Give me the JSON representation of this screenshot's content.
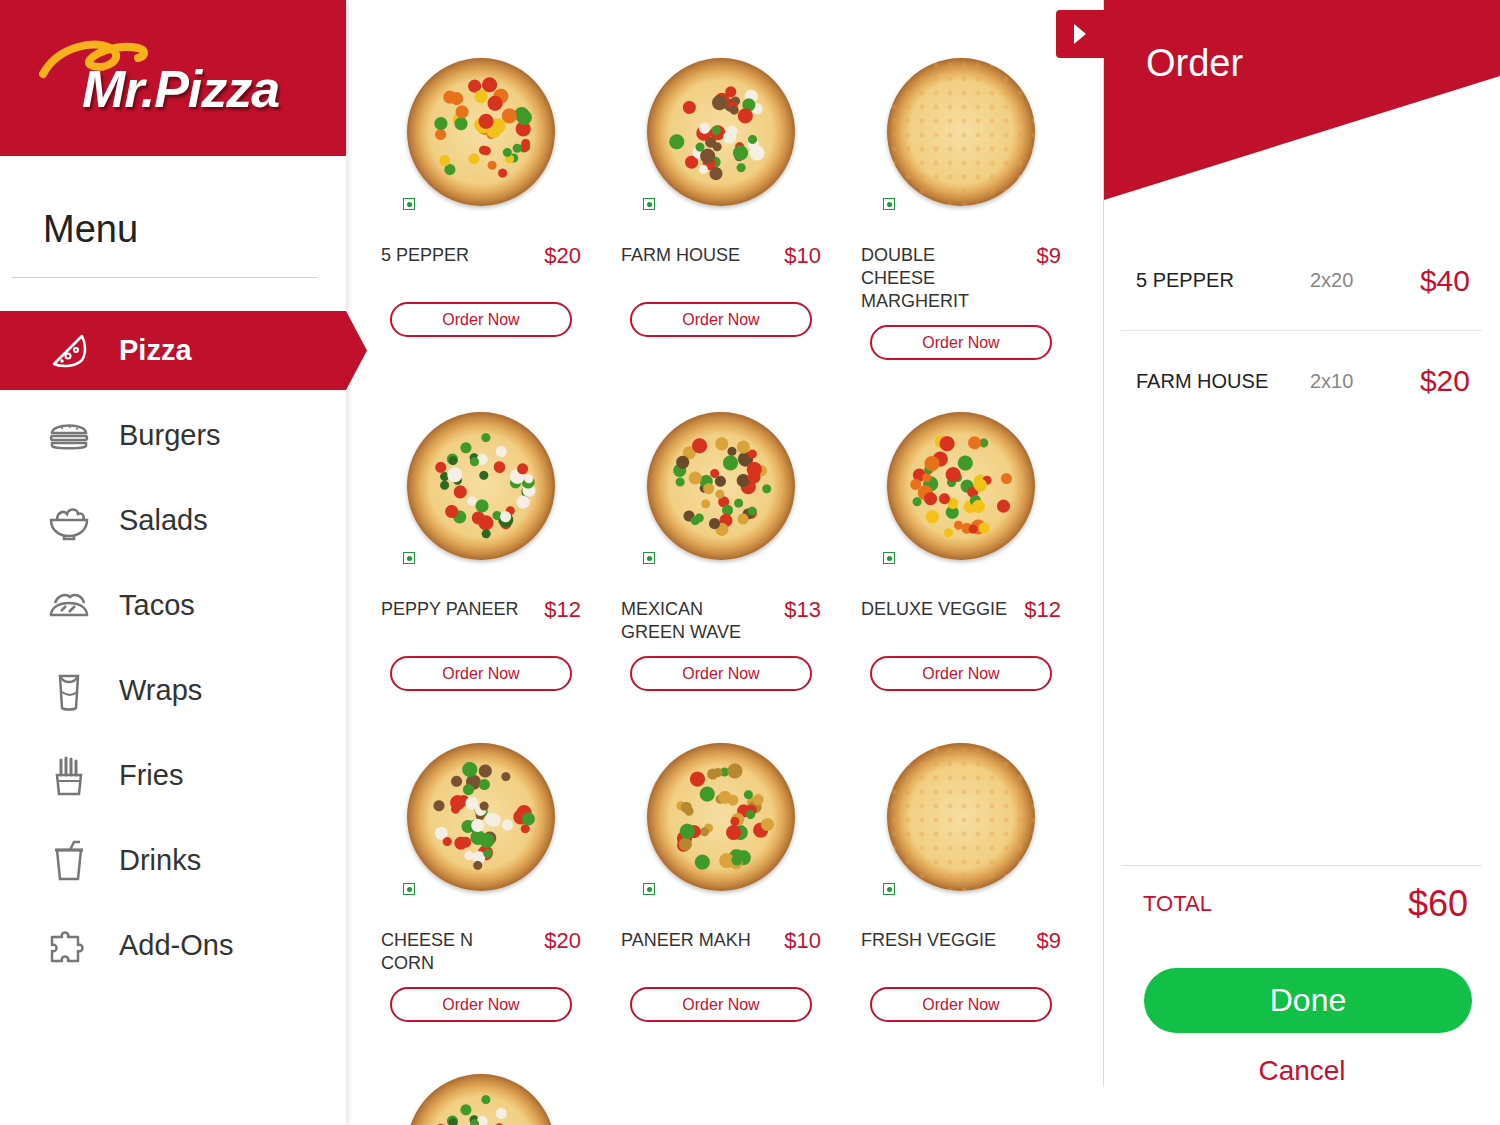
{
  "logo": {
    "text": "Mr.Pizza"
  },
  "sidebar": {
    "title": "Menu",
    "items": [
      {
        "label": "Pizza",
        "selected": true
      },
      {
        "label": "Burgers",
        "selected": false
      },
      {
        "label": "Salads",
        "selected": false
      },
      {
        "label": "Tacos",
        "selected": false
      },
      {
        "label": "Wraps",
        "selected": false
      },
      {
        "label": "Fries",
        "selected": false
      },
      {
        "label": "Drinks",
        "selected": false
      },
      {
        "label": "Add-Ons",
        "selected": false
      }
    ]
  },
  "products": [
    {
      "name": "5 PEPPER",
      "price": "$20",
      "button": "Order Now",
      "veg": true,
      "kind": "toppings"
    },
    {
      "name": "FARM HOUSE",
      "price": "$10",
      "button": "Order Now",
      "veg": true,
      "kind": "toppings"
    },
    {
      "name": "DOUBLE CHEESE MARGHERIT",
      "price": "$9",
      "button": "Order Now",
      "veg": true,
      "kind": "cheese"
    },
    {
      "name": "PEPPY PANEER",
      "price": "$12",
      "button": "Order Now",
      "veg": true,
      "kind": "toppings"
    },
    {
      "name": "MEXICAN GREEN WAVE",
      "price": "$13",
      "button": "Order Now",
      "veg": true,
      "kind": "toppings"
    },
    {
      "name": "DELUXE VEGGIE",
      "price": "$12",
      "button": "Order Now",
      "veg": true,
      "kind": "toppings"
    },
    {
      "name": "CHEESE N CORN",
      "price": "$20",
      "button": "Order Now",
      "veg": true,
      "kind": "toppings"
    },
    {
      "name": "PANEER MAKH",
      "price": "$10",
      "button": "Order Now",
      "veg": true,
      "kind": "toppings"
    },
    {
      "name": "FRESH VEGGIE",
      "price": "$9",
      "button": "Order Now",
      "veg": true,
      "kind": "cheese"
    }
  ],
  "more_below": true,
  "order": {
    "title": "Order",
    "items": [
      {
        "name": "5 PEPPER",
        "qty": "2x20",
        "amount": "$40"
      },
      {
        "name": "FARM HOUSE",
        "qty": "2x10",
        "amount": "$20"
      }
    ],
    "total_label": "TOTAL",
    "total": "$60",
    "done": "Done",
    "cancel": "Cancel"
  }
}
